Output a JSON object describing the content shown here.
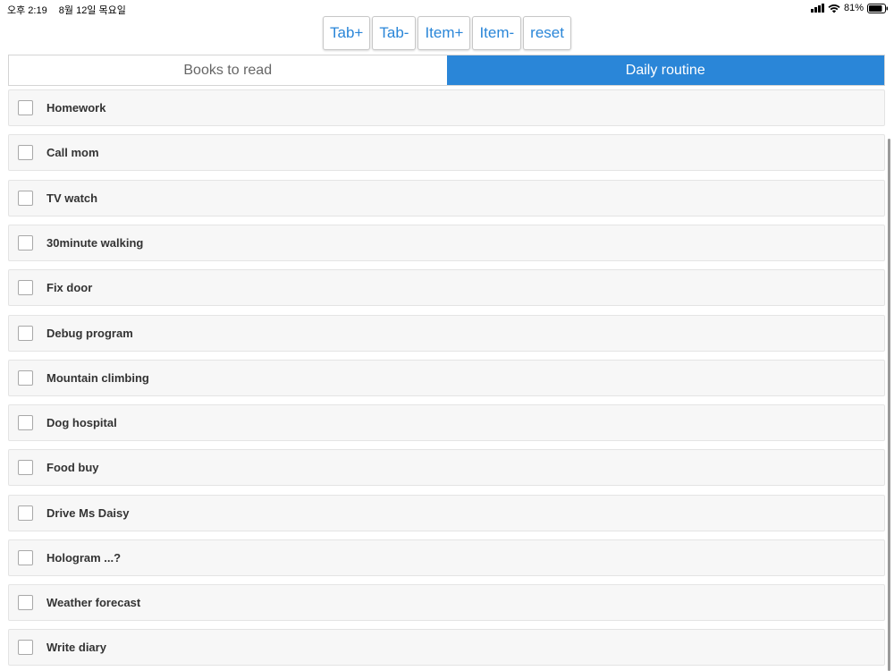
{
  "status_bar": {
    "time": "오후 2:19",
    "date": "8월 12일 목요일",
    "battery": "81%"
  },
  "toolbar": {
    "buttons": [
      "Tab+",
      "Tab-",
      "Item+",
      "Item-",
      "reset"
    ]
  },
  "tabs": [
    {
      "label": "Books to read",
      "active": false
    },
    {
      "label": "Daily routine",
      "active": true
    }
  ],
  "items": [
    {
      "label": "Homework",
      "checked": false
    },
    {
      "label": "Call mom",
      "checked": false
    },
    {
      "label": "TV watch",
      "checked": false
    },
    {
      "label": "30minute walking",
      "checked": false
    },
    {
      "label": "Fix door",
      "checked": false
    },
    {
      "label": "Debug program",
      "checked": false
    },
    {
      "label": "Mountain climbing",
      "checked": false
    },
    {
      "label": "Dog hospital",
      "checked": false
    },
    {
      "label": "Food buy",
      "checked": false
    },
    {
      "label": "Drive Ms Daisy",
      "checked": false
    },
    {
      "label": "Hologram ...?",
      "checked": false
    },
    {
      "label": "Weather forecast",
      "checked": false
    },
    {
      "label": "Write diary",
      "checked": false
    }
  ],
  "colors": {
    "accent": "#2a86d8",
    "item_background": "#f7f7f7"
  },
  "icons": {
    "signal": "cellular-signal-icon",
    "wifi": "wifi-icon",
    "battery": "battery-icon",
    "checkbox": "checkbox-icon"
  }
}
